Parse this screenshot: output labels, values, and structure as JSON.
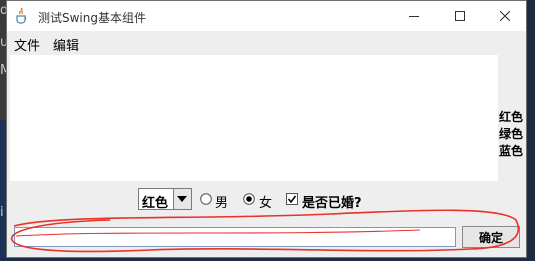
{
  "window": {
    "title": "测试Swing基本组件"
  },
  "menu": {
    "items": [
      "文件",
      "编辑"
    ]
  },
  "side_list": {
    "items": [
      "红色",
      "绿色",
      "蓝色"
    ]
  },
  "controls": {
    "combo_value": "红色",
    "gender_options": [
      "男",
      "女"
    ],
    "gender_selected": "女",
    "married_label": "是否已婚?",
    "married_checked": true
  },
  "bottom": {
    "text_value": "",
    "ok_label": "确定"
  },
  "background": {
    "left_glyphs": [
      "d",
      "u",
      "M",
      "i"
    ]
  },
  "colors": {
    "annotation": "#e8322a",
    "taskbar": "#1c2c46"
  }
}
